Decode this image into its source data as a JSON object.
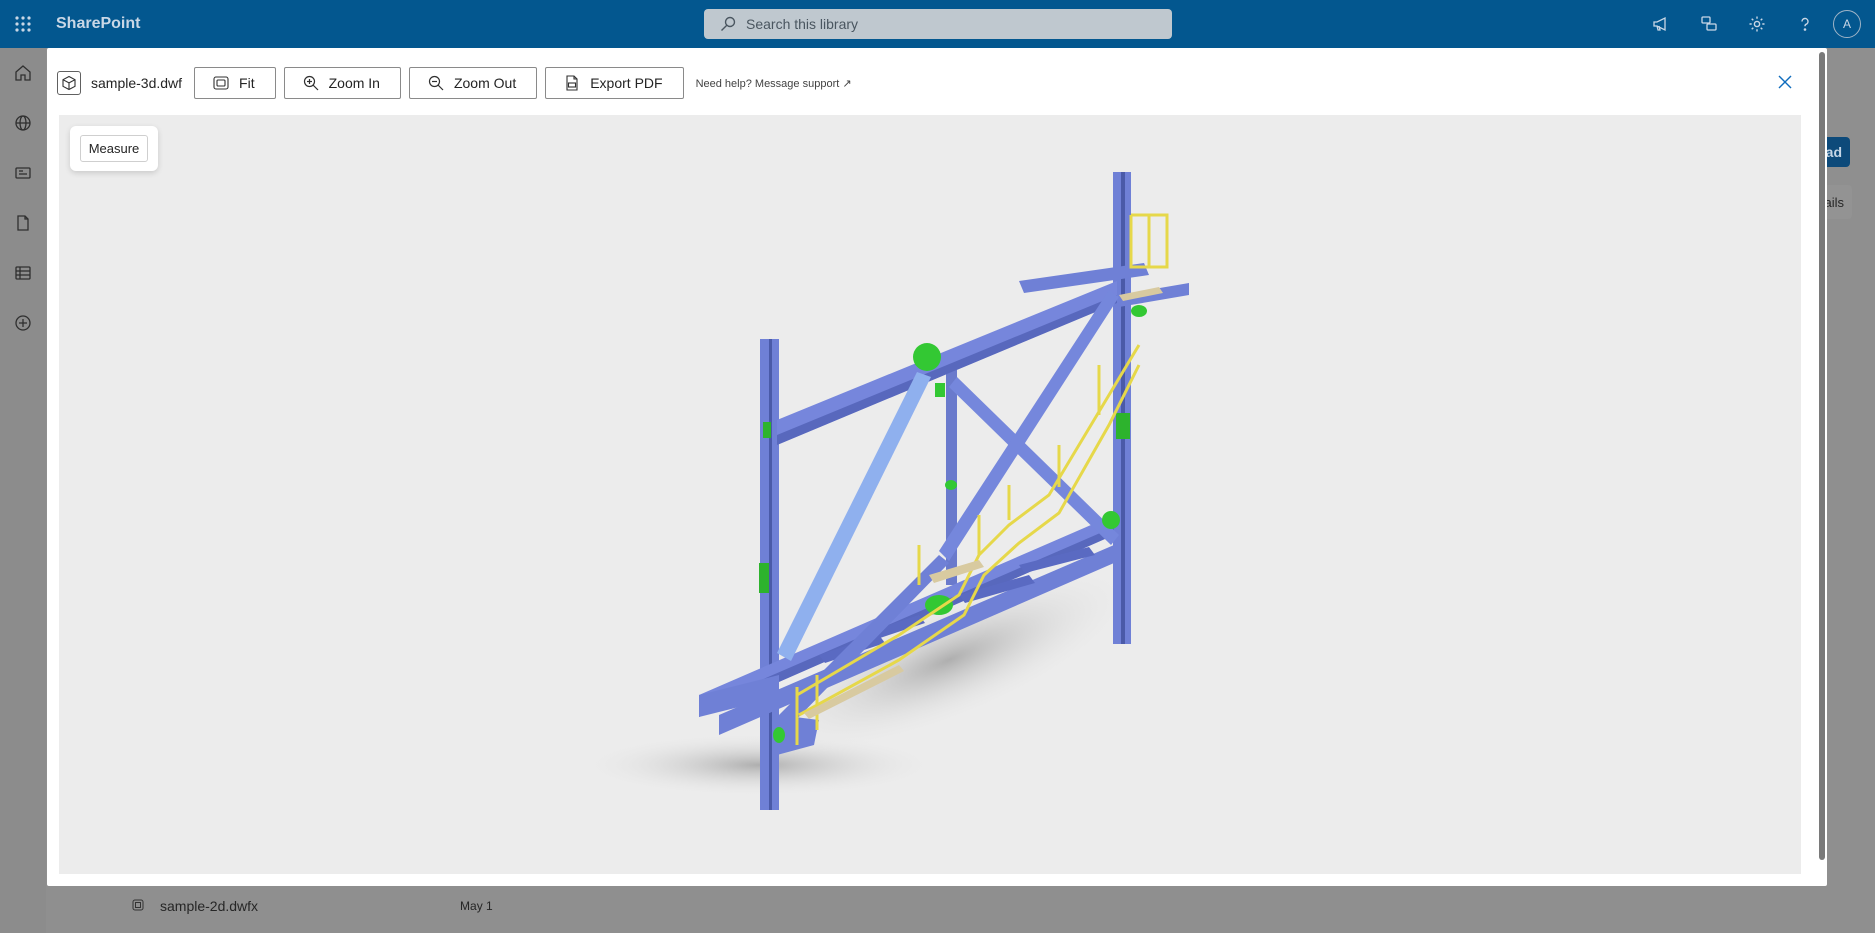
{
  "suite": {
    "app_name": "SharePoint",
    "search_placeholder": "Search this library",
    "avatar_initial": "A"
  },
  "background": {
    "upload_button": "oad",
    "details_button": "tails",
    "file_row": {
      "name": "sample-2d.dwfx",
      "date": "May 1"
    }
  },
  "viewer": {
    "filename": "sample-3d.dwf",
    "toolbar": {
      "fit": "Fit",
      "zoom_in": "Zoom In",
      "zoom_out": "Zoom Out",
      "export_pdf": "Export PDF"
    },
    "help_text": "Need help? Message support ↗",
    "measure_label": "Measure"
  },
  "colors": {
    "suite_bar": "#03578f",
    "steel": "#6f80d6",
    "connection": "#33c833",
    "railing": "#e6d84a"
  }
}
